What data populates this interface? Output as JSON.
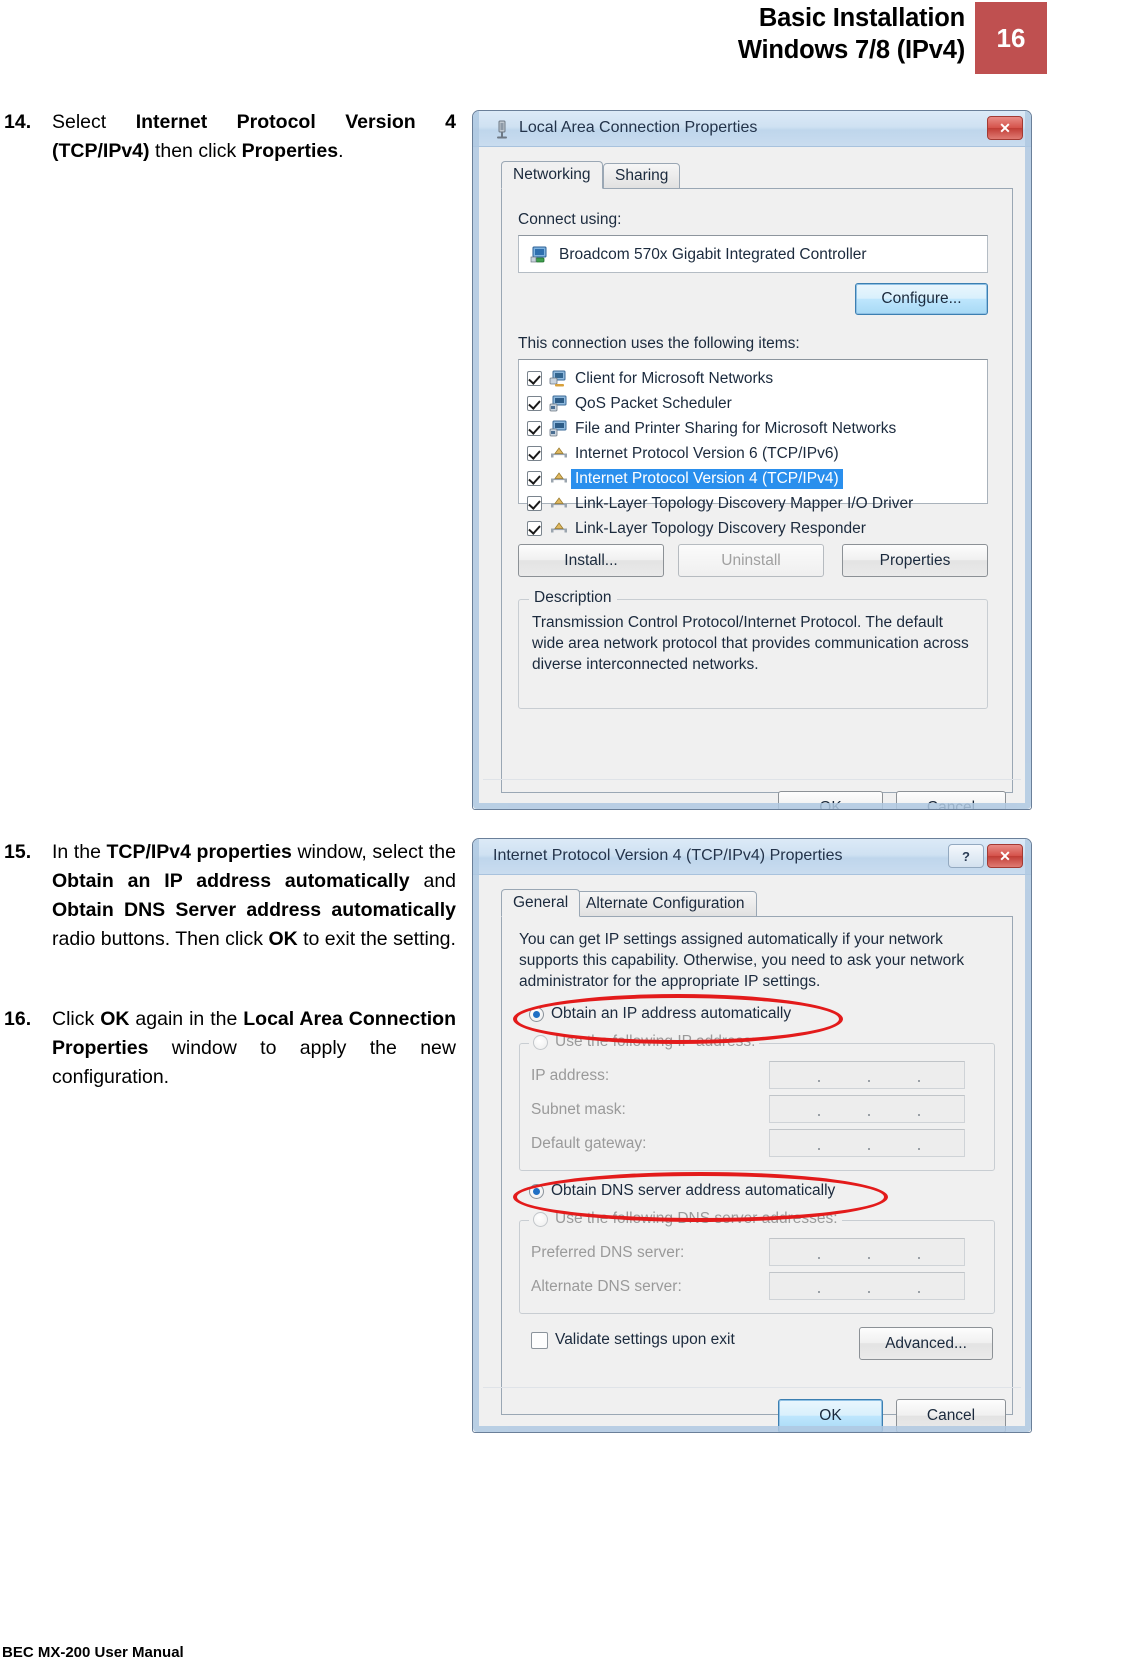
{
  "header": {
    "title_line1": "Basic Installation",
    "title_line2": "Windows 7/8 (IPv4)",
    "page_number": "16",
    "accent_color": "#bf5050"
  },
  "footer": {
    "text": "BEC MX-200 User Manual"
  },
  "steps": [
    {
      "number": "14.",
      "html": "Select <b>Internet Protocol Version 4 (TCP/IPv4)</b> then click <b>Properties</b>.",
      "plain": "Select Internet Protocol Version 4 (TCP/IPv4) then click Properties."
    },
    {
      "number": "15.",
      "html": "In the <b>TCP/IPv4 properties</b> window, select the <b>Obtain an IP address automatically</b> and <b>Obtain DNS Server address automatically</b> radio buttons. Then click <b>OK</b> to exit the setting.",
      "plain": "In the TCP/IPv4 properties window, select the Obtain an IP address automatically and Obtain DNS Server address automatically radio buttons. Then click OK to exit the setting."
    },
    {
      "number": "16.",
      "html": "Click <b>OK</b> again in the <b>Local Area Connection Properties</b> window to apply the new configuration.",
      "plain": "Click OK again in the Local Area Connection Properties window to apply the new configuration."
    }
  ],
  "dialog_lan": {
    "title": "Local Area Connection Properties",
    "title_icon": "network-adapter-icon",
    "close_button": "✕",
    "tabs": [
      {
        "label": "Networking",
        "active": true
      },
      {
        "label": "Sharing",
        "active": false
      }
    ],
    "connect_using_label": "Connect using:",
    "adapter_name": "Broadcom 570x Gigabit Integrated Controller",
    "adapter_icon": "network-card-icon",
    "configure_button": "Configure...",
    "items_label": "This connection uses the following items:",
    "items": [
      {
        "label": "Client for Microsoft Networks",
        "checked": true,
        "selected": false,
        "icon": "client-icon"
      },
      {
        "label": "QoS Packet Scheduler",
        "checked": true,
        "selected": false,
        "icon": "service-icon"
      },
      {
        "label": "File and Printer Sharing for Microsoft Networks",
        "checked": true,
        "selected": false,
        "icon": "service-icon"
      },
      {
        "label": "Internet Protocol Version 6 (TCP/IPv6)",
        "checked": true,
        "selected": false,
        "icon": "protocol-icon"
      },
      {
        "label": "Internet Protocol Version 4 (TCP/IPv4)",
        "checked": true,
        "selected": true,
        "icon": "protocol-icon"
      },
      {
        "label": "Link-Layer Topology Discovery Mapper I/O Driver",
        "checked": true,
        "selected": false,
        "icon": "protocol-icon"
      },
      {
        "label": "Link-Layer Topology Discovery Responder",
        "checked": true,
        "selected": false,
        "icon": "protocol-icon"
      }
    ],
    "install_button": "Install...",
    "uninstall_button": "Uninstall",
    "properties_button": "Properties",
    "description_group_title": "Description",
    "description_text": "Transmission Control Protocol/Internet Protocol. The default wide area network protocol that provides communication across diverse interconnected networks.",
    "ok_button": "OK",
    "cancel_button": "Cancel"
  },
  "dialog_tcpip": {
    "title": "Internet Protocol Version 4 (TCP/IPv4) Properties",
    "help_button": "?",
    "close_button": "✕",
    "tabs": [
      {
        "label": "General",
        "active": true
      },
      {
        "label": "Alternate Configuration",
        "active": false
      }
    ],
    "intro_text": "You can get IP settings assigned automatically if your network supports this capability. Otherwise, you need to ask your network administrator for the appropriate IP settings.",
    "radio_obtain_ip": {
      "label": "Obtain an IP address automatically",
      "selected": true
    },
    "radio_use_ip": {
      "label": "Use the following IP address:",
      "selected": false
    },
    "ip_fields": [
      {
        "label": "IP address:",
        "value": ""
      },
      {
        "label": "Subnet mask:",
        "value": ""
      },
      {
        "label": "Default gateway:",
        "value": ""
      }
    ],
    "radio_obtain_dns": {
      "label": "Obtain DNS server address automatically",
      "selected": true
    },
    "radio_use_dns": {
      "label": "Use the following DNS server addresses:",
      "selected": false
    },
    "dns_fields": [
      {
        "label": "Preferred DNS server:",
        "value": ""
      },
      {
        "label": "Alternate DNS server:",
        "value": ""
      }
    ],
    "validate_checkbox": {
      "label": "Validate settings upon exit",
      "checked": false
    },
    "advanced_button": "Advanced...",
    "ok_button": "OK",
    "cancel_button": "Cancel",
    "annotation_color": "#e31b1b"
  }
}
